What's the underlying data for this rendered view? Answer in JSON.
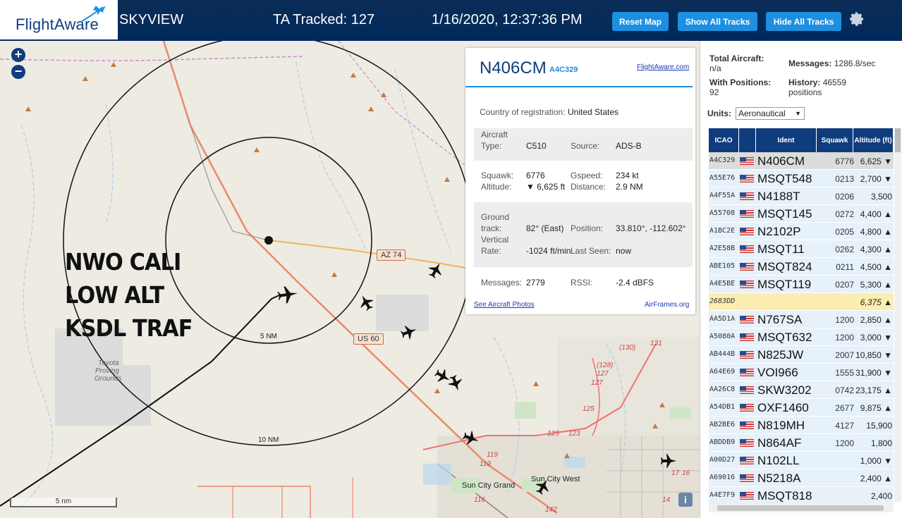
{
  "header": {
    "brand": "FlightAware",
    "app_title": "SKYVIEW",
    "tracked_label": "TA Tracked: 127",
    "datetime": "1/16/2020, 12:37:36 PM",
    "buttons": {
      "reset": "Reset Map",
      "show_all": "Show All Tracks",
      "hide_all": "Hide All Tracks"
    }
  },
  "map": {
    "zoom_in": "+",
    "zoom_out": "−",
    "overlay_lines": [
      "NWO CALI",
      "LOW ALT",
      "KSDL TRAF"
    ],
    "ring_labels": [
      "5 NM",
      "10 NM"
    ],
    "roads": [
      "AZ 74",
      "US 60"
    ],
    "places": [
      "Toyota",
      "Proving",
      "Grounds",
      "Sun City Grand",
      "Sun City West"
    ],
    "route_numbers": [
      "(130)",
      "131",
      "(128)",
      "127",
      "127",
      "125",
      "123",
      "123",
      "119",
      "119",
      "116",
      "142",
      "17",
      "16",
      "14"
    ],
    "scale_label": "5 nm",
    "info": "i"
  },
  "popup": {
    "callsign": "N406CM",
    "hex": "A4C329",
    "fa_link": "FlightAware.com",
    "country_label": "Country of registration:",
    "country_value": "United States",
    "aircraft_type_label_1": "Aircraft",
    "aircraft_type_label_2": "Type:",
    "aircraft_type": "C510",
    "source_label": "Source:",
    "source": "ADS-B",
    "squawk_label": "Squawk:",
    "squawk": "6776",
    "gspeed_label": "Gspeed:",
    "gspeed": "234 kt",
    "altitude_label": "Altitude:",
    "altitude": "▼ 6,625 ft",
    "distance_label": "Distance:",
    "distance": "2.9 NM",
    "track_label_1": "Ground",
    "track_label_2": "track:",
    "track": "82° (East)",
    "position_label": "Position:",
    "position": "33.810°, -112.602°",
    "vrate_label_1": "Vertical",
    "vrate_label_2": "Rate:",
    "vrate": "-1024 ft/min",
    "last_seen_label": "Last Seen:",
    "last_seen": "now",
    "messages_label": "Messages:",
    "messages": "2779",
    "rssi_label": "RSSI:",
    "rssi": "-2.4 dBFS",
    "photos_link": "See Aircraft Photos",
    "airframes_link": "AirFrames.org"
  },
  "side": {
    "total_label": "Total Aircraft:",
    "total_value": "n/a",
    "messages_label": "Messages:",
    "messages_value": "1286.8/sec",
    "positions_label": "With Positions:",
    "positions_value": "92",
    "history_label": "History:",
    "history_value": "46559",
    "history_unit": "positions",
    "units_label": "Units:",
    "units_value": "Aeronautical",
    "columns": [
      "ICAO",
      "",
      "Ident",
      "Squawk",
      "Altitude (ft)"
    ],
    "rows": [
      {
        "icao": "A4C329",
        "ident": "N406CM",
        "squawk": "6776",
        "alt": "6,625 ▼",
        "flag": true
      },
      {
        "icao": "A55E76",
        "ident": "MSQT548",
        "squawk": "0213",
        "alt": "2,700 ▼",
        "flag": true
      },
      {
        "icao": "A4F55A",
        "ident": "N4188T",
        "squawk": "0206",
        "alt": "3,500",
        "flag": true
      },
      {
        "icao": "A55708",
        "ident": "MSQT145",
        "squawk": "0272",
        "alt": "4,400 ▲",
        "flag": true
      },
      {
        "icao": "A1BC2E",
        "ident": "N2102P",
        "squawk": "0205",
        "alt": "4,800 ▲",
        "flag": true
      },
      {
        "icao": "A2E58B",
        "ident": "MSQT11",
        "squawk": "0262",
        "alt": "4,300 ▲",
        "flag": true
      },
      {
        "icao": "ABE105",
        "ident": "MSQT824",
        "squawk": "0211",
        "alt": "4,500 ▲",
        "flag": true
      },
      {
        "icao": "A4E5BE",
        "ident": "MSQT119",
        "squawk": "0207",
        "alt": "5,300 ▲",
        "flag": true
      },
      {
        "icao": "2683DD",
        "ident": "",
        "squawk": "",
        "alt": "6,375 ▲",
        "flag": false
      },
      {
        "icao": "AA5D1A",
        "ident": "N767SA",
        "squawk": "1200",
        "alt": "2,850 ▲",
        "flag": true
      },
      {
        "icao": "A5080A",
        "ident": "MSQT632",
        "squawk": "1200",
        "alt": "3,000 ▼",
        "flag": true
      },
      {
        "icao": "AB444B",
        "ident": "N825JW",
        "squawk": "2007",
        "alt": "10,850 ▼",
        "flag": true
      },
      {
        "icao": "A64E69",
        "ident": "VOI966",
        "squawk": "1555",
        "alt": "31,900 ▼",
        "flag": true
      },
      {
        "icao": "AA26C8",
        "ident": "SKW3202",
        "squawk": "0742",
        "alt": "23,175 ▲",
        "flag": true
      },
      {
        "icao": "A54DB1",
        "ident": "OXF1460",
        "squawk": "2677",
        "alt": "9,875 ▲",
        "flag": true
      },
      {
        "icao": "AB2BE6",
        "ident": "N819MH",
        "squawk": "4127",
        "alt": "15,900",
        "flag": true
      },
      {
        "icao": "ABDDB9",
        "ident": "N864AF",
        "squawk": "1200",
        "alt": "1,800",
        "flag": true
      },
      {
        "icao": "A00D27",
        "ident": "N102LL",
        "squawk": "",
        "alt": "1,000 ▼",
        "flag": true
      },
      {
        "icao": "A69016",
        "ident": "N5218A",
        "squawk": "",
        "alt": "2,400 ▲",
        "flag": true
      },
      {
        "icao": "A4E7F9",
        "ident": "MSQT818",
        "squawk": "",
        "alt": "2,400",
        "flag": true
      }
    ]
  },
  "colors": {
    "header_bg": "#0b2c56",
    "button": "#1d8fe0",
    "brand": "#0f3c7d",
    "row_bg": "#e6f1fa",
    "row_sel": "#dcdcdc",
    "row_hl": "#fbeeb0"
  }
}
